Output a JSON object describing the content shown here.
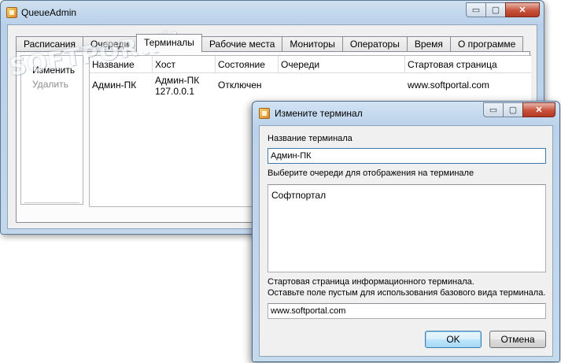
{
  "main_window": {
    "title": "QueueAdmin",
    "caption_buttons": {
      "minimize": "▭",
      "maximize": "▢",
      "close": "✕"
    },
    "tabs": [
      {
        "label": "Расписания",
        "active": false
      },
      {
        "label": "Очереди",
        "active": false
      },
      {
        "label": "Терминалы",
        "active": true
      },
      {
        "label": "Рабочие места",
        "active": false
      },
      {
        "label": "Мониторы",
        "active": false
      },
      {
        "label": "Операторы",
        "active": false
      },
      {
        "label": "Время",
        "active": false
      },
      {
        "label": "О программе",
        "active": false
      }
    ],
    "side_actions": {
      "edit": "Изменить",
      "delete": "Удалить"
    },
    "table": {
      "columns": [
        "Название",
        "Хост",
        "Состояние",
        "Очереди",
        "Стартовая страница"
      ],
      "rows": [
        {
          "name": "Админ-ПК",
          "host_line1": "Админ-ПК",
          "host_line2": "127.0.0.1",
          "state": "Отключен",
          "queues": "",
          "start_page": "www.softportal.com"
        }
      ]
    },
    "watermark": {
      "text": "SOFTPORTAL",
      "url": "www.softportal.com",
      "mark": "®"
    }
  },
  "dialog": {
    "title": "Измените терминал",
    "caption_buttons": {
      "minimize": "▭",
      "maximize": "▢",
      "close": "✕"
    },
    "name_label": "Название терминала",
    "name_value": "Админ-ПК",
    "queues_label": "Выберите очереди для отображения на терминале",
    "queues": [
      "Софтпортал"
    ],
    "start_page_hint_line1": "Стартовая страница информационного терминала.",
    "start_page_hint_line2": "Оставьте поле пустым для использования базового вида терминала.",
    "start_page_value": "www.softportal.com",
    "ok_label": "OK",
    "cancel_label": "Отмена"
  },
  "colors": {
    "window_frame": "#b9d1ea",
    "close_button": "#c8523b",
    "default_button": "#3c7fb1"
  }
}
